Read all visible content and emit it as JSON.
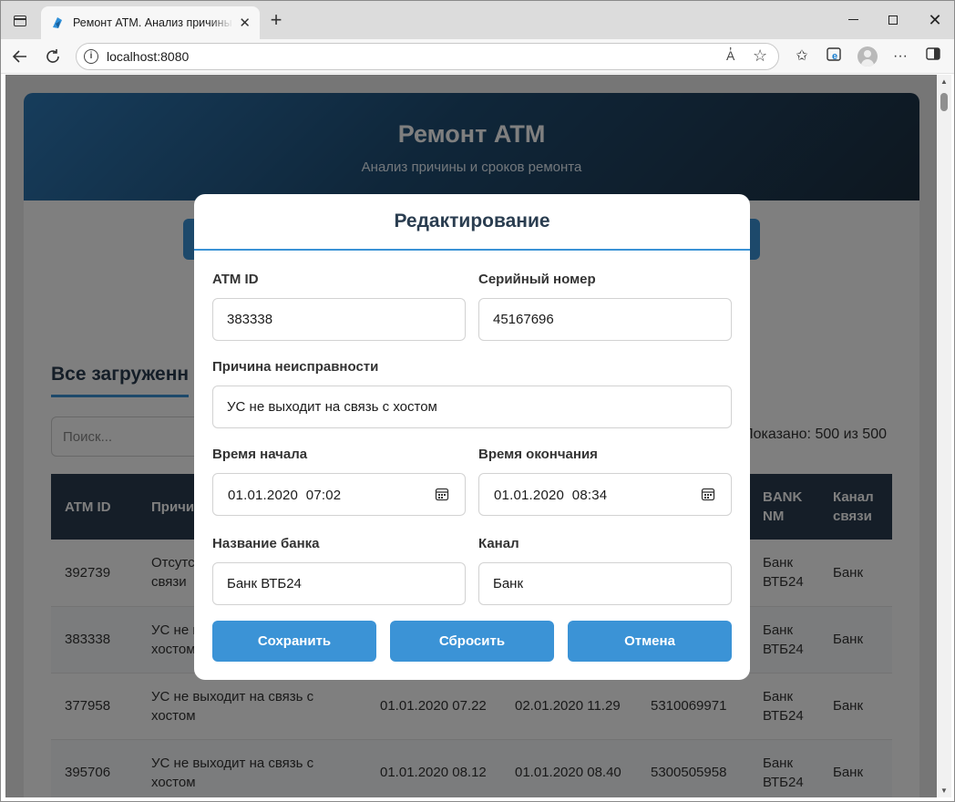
{
  "browser": {
    "tab_title": "Ремонт ATM. Анализ причины и сроков ремонта",
    "url": "localhost:8080",
    "read_aloud_label": "A̓"
  },
  "page": {
    "title": "Ремонт ATM",
    "subtitle": "Анализ причины и сроков ремонта",
    "section_title": "Все загруженн",
    "search_placeholder": "Поиск...",
    "shown_count": "Показано: 500 из 500",
    "table": {
      "headers": [
        "ATM ID",
        "Причи",
        "",
        "",
        "",
        "BANK NM",
        "Канал связи"
      ],
      "rows": [
        [
          "392739",
          "Отсутс\nсвязи",
          "",
          "",
          "",
          "Банк ВТБ24",
          "Банк"
        ],
        [
          "383338",
          "УС не в\nхостом",
          "",
          "",
          "",
          "Банк ВТБ24",
          "Банк"
        ],
        [
          "377958",
          "УС не выходит на связь с хостом",
          "01.01.2020 07.22",
          "02.01.2020 11.29",
          "5310069971",
          "Банк ВТБ24",
          "Банк"
        ],
        [
          "395706",
          "УС не выходит на связь с хостом",
          "01.01.2020 08.12",
          "01.01.2020 08.40",
          "5300505958",
          "Банк ВТБ24",
          "Банк"
        ]
      ]
    }
  },
  "modal": {
    "title": "Редактирование",
    "atm_id": {
      "label": "ATM ID",
      "value": "383338"
    },
    "serial": {
      "label": "Серийный номер",
      "value": "45167696"
    },
    "reason": {
      "label": "Причина неисправности",
      "value": "УС не выходит на связь с хостом"
    },
    "start": {
      "label": "Время начала",
      "value": "01.01.2020  07:02"
    },
    "end": {
      "label": "Время окончания",
      "value": "01.01.2020  08:34"
    },
    "bank": {
      "label": "Название банка",
      "value": "Банк ВТБ24"
    },
    "channel": {
      "label": "Канал",
      "value": "Банк"
    },
    "buttons": {
      "save": "Сохранить",
      "reset": "Сбросить",
      "cancel": "Отмена"
    }
  },
  "colors": {
    "accent": "#3b93d6",
    "header_dark": "#2a3d50",
    "overlay": "rgba(0,0,0,0.5)"
  }
}
